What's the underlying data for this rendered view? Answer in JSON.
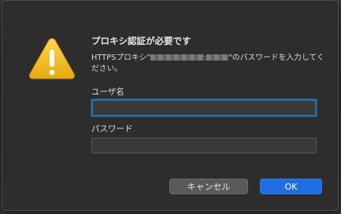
{
  "dialog": {
    "title": "プロキシ認証が必要です",
    "message_prefix": "HTTPSプロキシ\"",
    "message_sep": ":",
    "message_suffix": "\"のパスワードを入力してください。",
    "icon": "warning-triangle-icon",
    "accent_color": "#f2c230"
  },
  "form": {
    "username_label": "ユーザ名",
    "username_value": "",
    "password_label": "パスワード",
    "password_value": ""
  },
  "buttons": {
    "cancel_label": "キャンセル",
    "ok_label": "OK",
    "ok_color": "#1f6fe0"
  }
}
